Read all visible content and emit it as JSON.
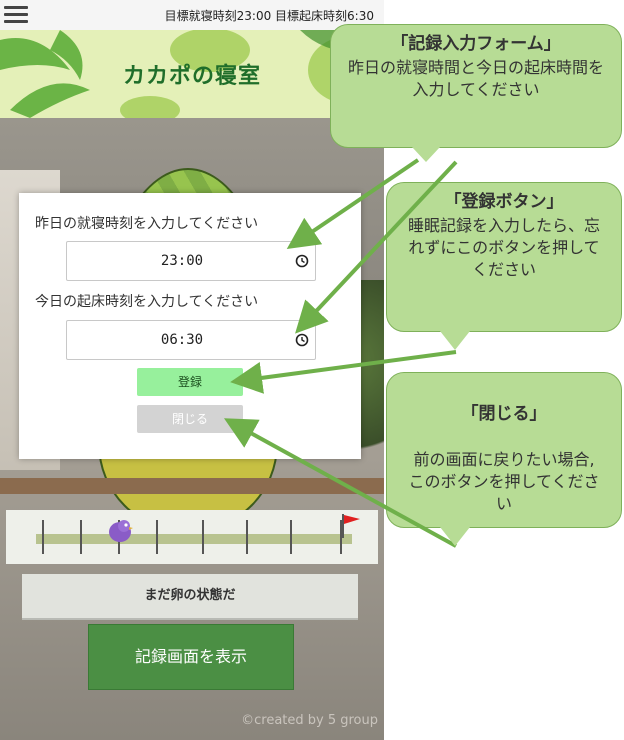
{
  "statusbar": {
    "target_times": "目標就寝時刻23:00 目標起床時刻6:30"
  },
  "app": {
    "title": "カカポの寝室",
    "status_text": "まだ卵の状態だ",
    "show_record_label": "記録画面を表示",
    "credit": "©created by 5 group"
  },
  "form": {
    "bedtime_label": "昨日の就寝時刻を入力してください",
    "bedtime_value": "23:00",
    "wakeup_label": "今日の起床時刻を入力してください",
    "wakeup_value": "06:30",
    "register_label": "登録",
    "close_label": "閉じる"
  },
  "callouts": {
    "form": {
      "title": "「記録入力フォーム」",
      "body": "昨日の就寝時間と今日の起床時間を入力してください"
    },
    "register": {
      "title": "「登録ボタン」",
      "body": "睡眠記録を入力したら、忘れずにこのボタンを押してください"
    },
    "close": {
      "title": "「閉じる」",
      "body": "前の画面に戻りたい場合,\nこのボタンを押してください"
    }
  },
  "colors": {
    "callout_fill": "#b7dc95",
    "arrow": "#6fb04a",
    "register_button": "#97f09c",
    "close_button": "#d3d3d3",
    "show_record_button": "#4b8f44"
  },
  "icons": [
    "menu-icon",
    "clock-icon",
    "bird-icon",
    "goal-flag-icon"
  ]
}
